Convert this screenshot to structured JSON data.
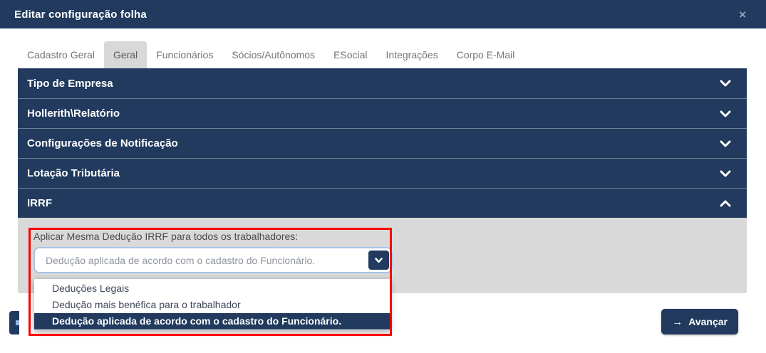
{
  "title_bar": {
    "title": "Editar configuração folha",
    "close_icon": "×"
  },
  "tabs": [
    {
      "label": "Cadastro Geral",
      "active": false
    },
    {
      "label": "Geral",
      "active": true
    },
    {
      "label": "Funcionários",
      "active": false
    },
    {
      "label": "Sócios/Autônomos",
      "active": false
    },
    {
      "label": "ESocial",
      "active": false
    },
    {
      "label": "Integrações",
      "active": false
    },
    {
      "label": "Corpo E-Mail",
      "active": false
    }
  ],
  "accordion": [
    {
      "label": "Tipo de Empresa",
      "expanded": false
    },
    {
      "label": "Hollerith\\Relatório",
      "expanded": false
    },
    {
      "label": "Configurações de Notificação",
      "expanded": false
    },
    {
      "label": "Lotação Tributária",
      "expanded": false
    },
    {
      "label": "IRRF",
      "expanded": true
    }
  ],
  "irrf_panel": {
    "field_label": "Aplicar Mesma Dedução IRRF para todos os trabalhadores:",
    "select_value": "Dedução aplicada de acordo com o cadastro do Funcionário.",
    "dropdown_options": [
      {
        "label": "Deduções Legais",
        "selected": false
      },
      {
        "label": "Dedução mais benéfica para o trabalhador",
        "selected": false
      },
      {
        "label": "Dedução aplicada de acordo com o cadastro do Funcionário.",
        "selected": true
      }
    ]
  },
  "footer": {
    "advance_button": {
      "label": "Avançar",
      "arrow": "→"
    }
  },
  "colors": {
    "navy": "#213a5e",
    "panel_gray": "#d9d9d9",
    "tab_active_bg": "#d8d8d8",
    "select_border": "#a7c5e8",
    "annotation_red": "#ff0000"
  }
}
